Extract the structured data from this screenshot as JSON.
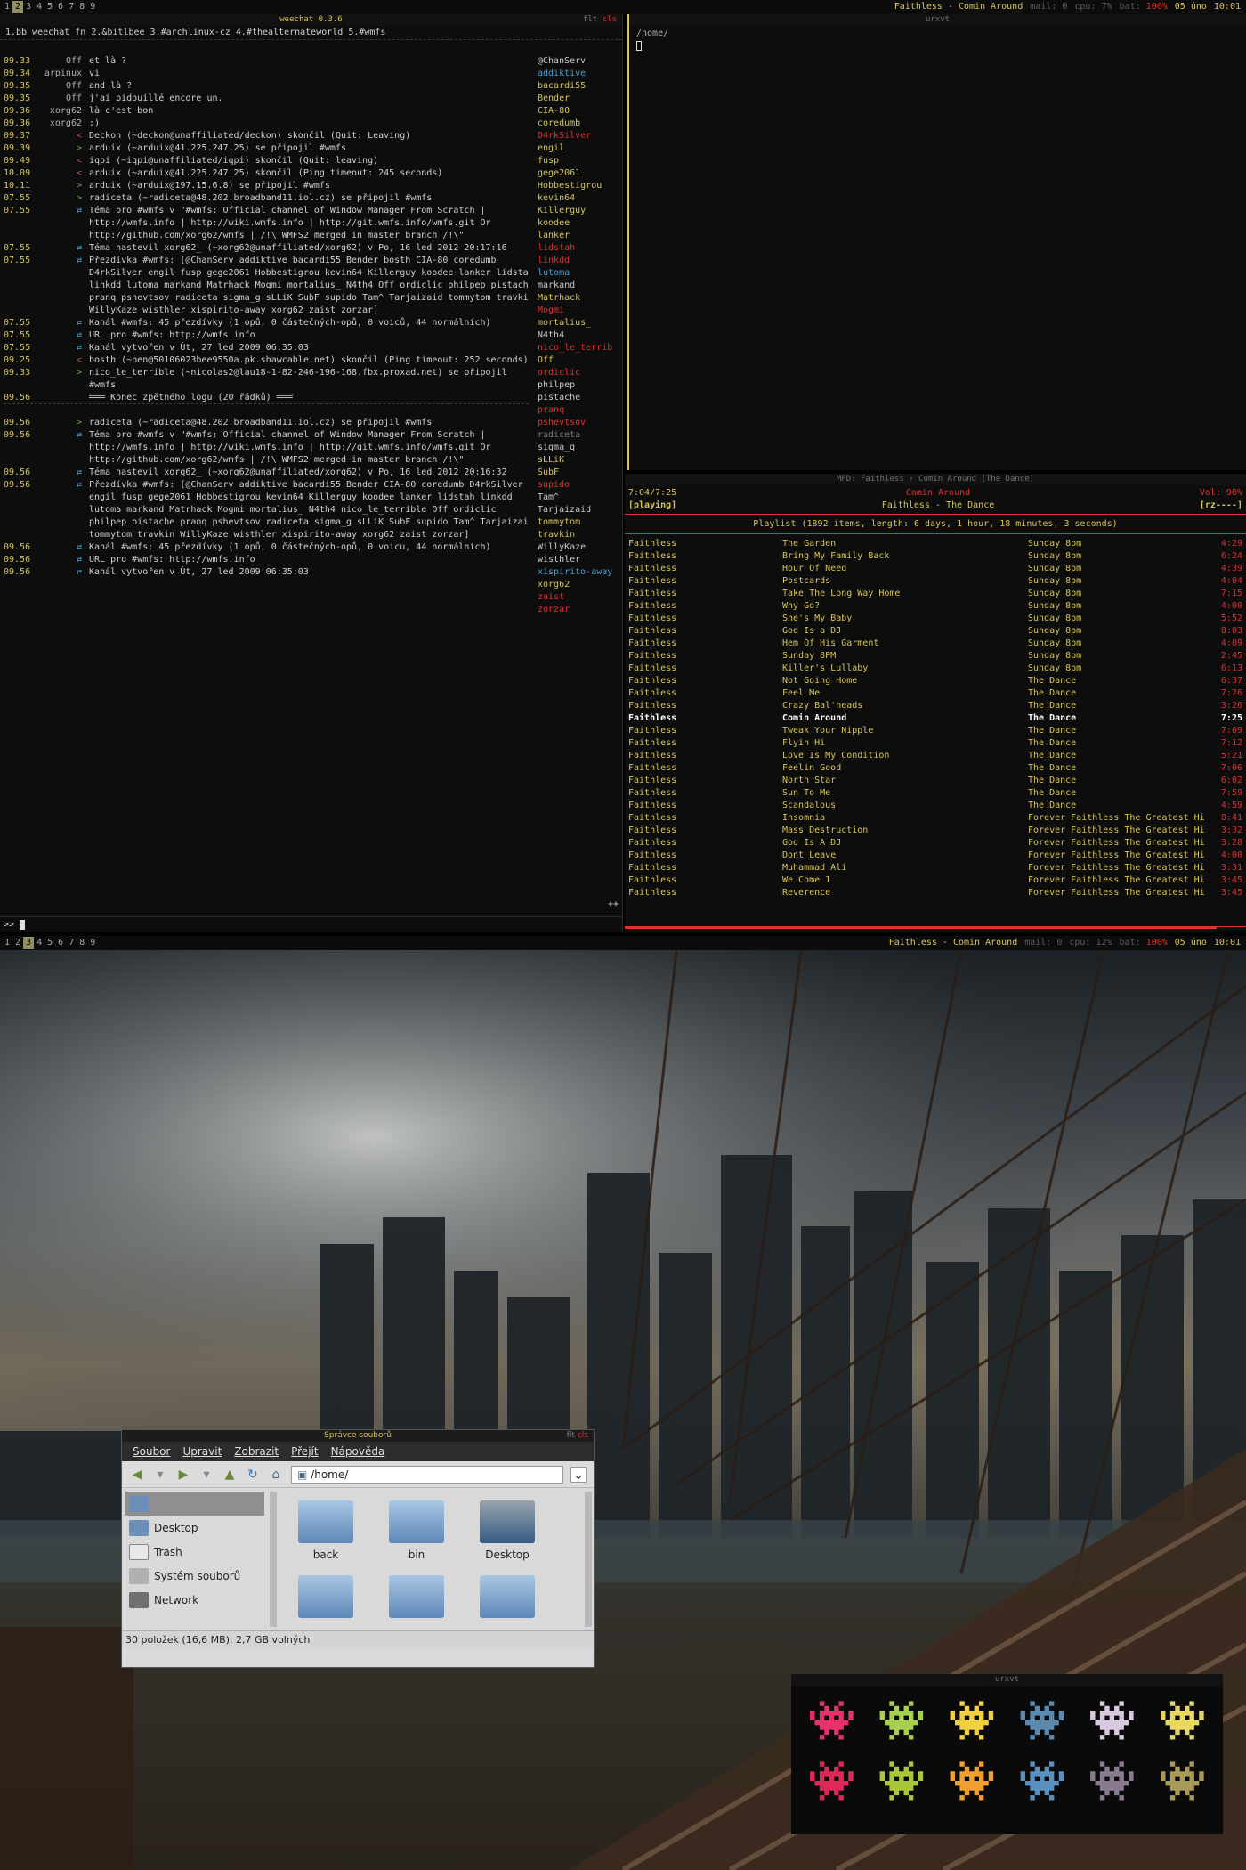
{
  "top_bar": {
    "tags": [
      "1",
      "2",
      "3",
      "4",
      "5",
      "6",
      "7",
      "8",
      "9"
    ],
    "active_tag": 1,
    "now_playing": "Faithless - Comin Around",
    "mail": "mail: 0",
    "cpu": "cpu: 7%",
    "bat_label": "bat:",
    "bat_value": "100%",
    "date": "05 úno",
    "time": "10:01"
  },
  "bottom_bar": {
    "active_tag": 2,
    "cpu": "cpu: 12%"
  },
  "weechat": {
    "title": "weechat 0.3.6",
    "buffers": "1.bb weechat fn 2.&bitlbee 3.#archlinux-cz 4.#thealternateworld 5.#wmfs",
    "flt": "flt",
    "cls": "cls",
    "lines": [
      [
        "09.33",
        "Off",
        "et là ?"
      ],
      [
        "09.34",
        "arpinux",
        "vi"
      ],
      [
        "09.35",
        "Off",
        "and là ?"
      ],
      [
        "09.35",
        "Off",
        "j'ai bidouillé encore un."
      ],
      [
        "09.36",
        "xorg62",
        "là c'est bon"
      ],
      [
        "09.36",
        "xorg62",
        ":)"
      ],
      [
        "09.37",
        "<",
        "Deckon (~deckon@unaffiliated/deckon) skončil (Quit: Leaving)"
      ],
      [
        "09.39",
        ">",
        "arduix (~arduix@41.225.247.25) se připojil #wmfs"
      ],
      [
        "09.49",
        "<",
        "iqpi (~iqpi@unaffiliated/iqpi) skončil (Quit: leaving)"
      ],
      [
        "10.09",
        "<",
        "arduix (~arduix@41.225.247.25) skončil (Ping timeout: 245 seconds)"
      ],
      [
        "10.11",
        ">",
        "arduix (~arduix@197.15.6.8) se připojil #wmfs"
      ],
      [
        "07.55",
        ">",
        "radiceta (~radiceta@48.202.broadband11.iol.cz) se připojil #wmfs"
      ],
      [
        "07.55",
        "⇄",
        "Téma pro #wmfs v \"#wmfs: Official channel of Window Manager From Scratch |"
      ],
      [
        "",
        "",
        "http://wmfs.info | http://wiki.wmfs.info | http://git.wmfs.info/wmfs.git Or"
      ],
      [
        "",
        "",
        "http://github.com/xorg62/wmfs | /!\\ WMFS2 merged in master branch /!\\\""
      ],
      [
        "07.55",
        "⇄",
        "Téma nastevil xorg62_ (~xorg62@unaffiliated/xorg62) v Po, 16 led 2012 20:17:16"
      ],
      [
        "07.55",
        "⇄",
        "Přezdívka #wmfs: [@ChanServ addiktive bacardi55 Bender bosth CIA-80 coredumb"
      ],
      [
        "",
        "",
        "D4rkSilver engil fusp gege2061 Hobbestigrou kevin64 Killerguy koodee lanker lidstah"
      ],
      [
        "",
        "",
        "linkdd lutoma markand Matrhack Mogmi mortalius_ N4th4 Off ordiclic philpep pistache"
      ],
      [
        "",
        "",
        "pranq pshevtsov radiceta sigma_g sLLiK SubF supido Tam^ Tarjaizaid tommytom travkin"
      ],
      [
        "",
        "",
        "WillyKaze wisthler xispirito-away xorg62 zaist zorzar]"
      ],
      [
        "07.55",
        "⇄",
        "Kanál #wmfs: 45 přezdívky (1 opů, 0 částečných-opů, 0 voiců, 44 normálních)"
      ],
      [
        "07.55",
        "⇄",
        "URL pro #wmfs: http://wmfs.info"
      ],
      [
        "07.55",
        "⇄",
        "Kanál vytvořen v Út, 27 led 2009 06:35:03"
      ],
      [
        "09.25",
        "<",
        "bosth (~ben@50106023bee9550a.pk.shawcable.net) skončil (Ping timeout: 252 seconds)"
      ],
      [
        "09.33",
        ">",
        "nico_le_terrible (~nicolas2@lau18-1-82-246-196-168.fbx.proxad.net) se připojil"
      ],
      [
        "",
        "",
        "#wmfs"
      ],
      [
        "09.56",
        "",
        "═══ Konec zpětného logu (20 řádků) ═══"
      ],
      [
        "",
        "",
        ""
      ],
      [
        "09.56",
        ">",
        "radiceta (~radiceta@48.202.broadband11.iol.cz) se připojil #wmfs"
      ],
      [
        "09.56",
        "⇄",
        "Téma pro #wmfs v \"#wmfs: Official channel of Window Manager From Scratch |"
      ],
      [
        "",
        "",
        "http://wmfs.info | http://wiki.wmfs.info | http://git.wmfs.info/wmfs.git Or"
      ],
      [
        "",
        "",
        "http://github.com/xorg62/wmfs | /!\\ WMFS2 merged in master branch /!\\\""
      ],
      [
        "09.56",
        "⇄",
        "Téma nastevil xorg62_ (~xorg62@unaffiliated/xorg62) v Po, 16 led 2012 20:16:32"
      ],
      [
        "09.56",
        "⇄",
        "Přezdívka #wmfs: [@ChanServ addiktive bacardi55 Bender CIA-80 coredumb D4rkSilver"
      ],
      [
        "",
        "",
        "engil fusp gege2061 Hobbestigrou kevin64 Killerguy koodee lanker lidstah linkdd"
      ],
      [
        "",
        "",
        "lutoma markand Matrhack Mogmi mortalius_ N4th4 nico_le_terrible Off ordiclic"
      ],
      [
        "",
        "",
        "philpep pistache pranq pshevtsov radiceta sigma_g sLLiK SubF supido Tam^ Tarjaizaid"
      ],
      [
        "",
        "",
        "tommytom travkin WillyKaze wisthler xispirito-away xorg62 zaist zorzar]"
      ],
      [
        "09.56",
        "⇄",
        "Kanál #wmfs: 45 přezdívky (1 opů, 0 částečných-opů, 0 voicu, 44 normálních)"
      ],
      [
        "09.56",
        "⇄",
        "URL pro #wmfs: http://wmfs.info"
      ],
      [
        "09.56",
        "⇄",
        "Kanál vytvořen v Út, 27 led 2009 06:35:03"
      ]
    ],
    "nicks": [
      [
        "@ChanServ",
        "#c8c8c8"
      ],
      [
        "addiktive",
        "#4aa0d0"
      ],
      [
        "bacardi55",
        "#d6c35b"
      ],
      [
        "Bender",
        "#d6c35b"
      ],
      [
        "CIA-80",
        "#d6c35b"
      ],
      [
        "coredumb",
        "#d6c35b"
      ],
      [
        "D4rkSilver",
        "#e03030"
      ],
      [
        "engil",
        "#d6c35b"
      ],
      [
        "fusp",
        "#d6c35b"
      ],
      [
        "gege2061",
        "#d6c35b"
      ],
      [
        "Hobbestigrou",
        "#d6c35b"
      ],
      [
        "kevin64",
        "#d6c35b"
      ],
      [
        "Killerguy",
        "#d6c35b"
      ],
      [
        "koodee",
        "#d6c35b"
      ],
      [
        "lanker",
        "#d6c35b"
      ],
      [
        "lidstah",
        "#e03030"
      ],
      [
        "linkdd",
        "#e03030"
      ],
      [
        "lutoma",
        "#4aa0d0"
      ],
      [
        "markand",
        "#c8c8c8"
      ],
      [
        "Matrhack",
        "#d6c35b"
      ],
      [
        "Mogmi",
        "#e03030"
      ],
      [
        "mortalius_",
        "#d6c35b"
      ],
      [
        "N4th4",
        "#c8c8c8"
      ],
      [
        "nico_le_terrib",
        "#e03030"
      ],
      [
        "Off",
        "#d6c35b"
      ],
      [
        "ordiclic",
        "#e03030"
      ],
      [
        "philpep",
        "#c8c8c8"
      ],
      [
        "pistache",
        "#c8c8c8"
      ],
      [
        "pranq",
        "#e03030"
      ],
      [
        "pshevtsov",
        "#e03030"
      ],
      [
        "radiceta",
        "#7a7a7a"
      ],
      [
        "sigma_g",
        "#c8c8c8"
      ],
      [
        "sLLiK",
        "#d6c35b"
      ],
      [
        "SubF",
        "#d6c35b"
      ],
      [
        "supido",
        "#e03030"
      ],
      [
        "Tam^",
        "#c8c8c8"
      ],
      [
        "Tarjaizaid",
        "#c8c8c8"
      ],
      [
        "tommytom",
        "#d6c35b"
      ],
      [
        "travkin",
        "#d6c35b"
      ],
      [
        "WillyKaze",
        "#c8c8c8"
      ],
      [
        "wisthler",
        "#c8c8c8"
      ],
      [
        "xispirito-away",
        "#4aa0d0"
      ],
      [
        "xorg62",
        "#d6c35b"
      ],
      [
        "zaist",
        "#e03030"
      ],
      [
        "zorzar",
        "#e03030"
      ]
    ],
    "prompt": ">>",
    "more": "++"
  },
  "urxvt1": {
    "title": "urxvt",
    "path": "/home/"
  },
  "mpd": {
    "title": "MPD: Faithless › Comin Around [The Dance]",
    "elapsed": "7:04/7:25",
    "song": "Comin Around",
    "artist_album_artist": "Faithless",
    "artist_album_sep": "-",
    "artist_album_album": "The Dance",
    "vol": "Vol: 90%",
    "state": "[playing]",
    "flags": "[rz----]",
    "playlist_header": "Playlist (1892 items, length: 6 days, 1 hour, 18 minutes, 3 seconds)",
    "current_index": 14,
    "tracks": [
      [
        "Faithless",
        "The Garden",
        "Sunday 8pm",
        "4:29"
      ],
      [
        "Faithless",
        "Bring My Family Back",
        "Sunday 8pm",
        "6:24"
      ],
      [
        "Faithless",
        "Hour Of Need",
        "Sunday 8pm",
        "4:39"
      ],
      [
        "Faithless",
        "Postcards",
        "Sunday 8pm",
        "4:04"
      ],
      [
        "Faithless",
        "Take The Long Way Home",
        "Sunday 8pm",
        "7:15"
      ],
      [
        "Faithless",
        "Why Go?",
        "Sunday 8pm",
        "4:00"
      ],
      [
        "Faithless",
        "She's My Baby",
        "Sunday 8pm",
        "5:52"
      ],
      [
        "Faithless",
        "God Is a DJ",
        "Sunday 8pm",
        "8:03"
      ],
      [
        "Faithless",
        "Hem Of His Garment",
        "Sunday 8pm",
        "4:09"
      ],
      [
        "Faithless",
        "Sunday 8PM",
        "Sunday 8pm",
        "2:45"
      ],
      [
        "Faithless",
        "Killer's Lullaby",
        "Sunday 8pm",
        "6:13"
      ],
      [
        "Faithless",
        "Not Going Home",
        "The Dance",
        "6:37"
      ],
      [
        "Faithless",
        "Feel Me",
        "The Dance",
        "7:26"
      ],
      [
        "Faithless",
        "Crazy Bal'heads",
        "The Dance",
        "3:26"
      ],
      [
        "Faithless",
        "Comin Around",
        "The Dance",
        "7:25"
      ],
      [
        "Faithless",
        "Tweak Your Nipple",
        "The Dance",
        "7:09"
      ],
      [
        "Faithless",
        "Flyin Hi",
        "The Dance",
        "7:12"
      ],
      [
        "Faithless",
        "Love Is My Condition",
        "The Dance",
        "5:21"
      ],
      [
        "Faithless",
        "Feelin Good",
        "The Dance",
        "7:06"
      ],
      [
        "Faithless",
        "North Star",
        "The Dance",
        "6:02"
      ],
      [
        "Faithless",
        "Sun To Me",
        "The Dance",
        "7:59"
      ],
      [
        "Faithless",
        "Scandalous",
        "The Dance",
        "4:59"
      ],
      [
        "Faithless",
        "Insomnia",
        "Forever Faithless The Greatest Hi",
        "8:41"
      ],
      [
        "Faithless",
        "Mass Destruction",
        "Forever Faithless The Greatest Hi",
        "3:32"
      ],
      [
        "Faithless",
        "God Is A DJ",
        "Forever Faithless The Greatest Hi",
        "3:28"
      ],
      [
        "Faithless",
        "Dont Leave",
        "Forever Faithless The Greatest Hi",
        "4:00"
      ],
      [
        "Faithless",
        "Muhammad Ali",
        "Forever Faithless The Greatest Hi",
        "3:31"
      ],
      [
        "Faithless",
        "We Come 1",
        "Forever Faithless The Greatest Hi",
        "3:45"
      ],
      [
        "Faithless",
        "Reverence",
        "Forever Faithless The Greatest Hi",
        "3:45"
      ]
    ]
  },
  "filemanager": {
    "title": "Správce souborů",
    "flt": "flt",
    "cls": "cls",
    "menu": [
      "Soubor",
      "Upravit",
      "Zobrazit",
      "Přejít",
      "Nápověda"
    ],
    "path": "/home/",
    "places": [
      "",
      "Desktop",
      "Trash",
      "Systém souborů",
      "Network"
    ],
    "files": [
      "back",
      "bin",
      "Desktop",
      "",
      "",
      ""
    ],
    "status": "30 položek (16,6 MB), 2,7 GB volných"
  },
  "invaders": {
    "title": "urxvt",
    "glyph": "👾",
    "colors": [
      "#e8306a",
      "#a8d050",
      "#f0d040",
      "#5a8ab0",
      "#d8c8e0",
      "#e8d860",
      "#e02858",
      "#a8c838",
      "#f0a030",
      "#5a90c0",
      "#8a7a90",
      "#a89a58"
    ]
  }
}
